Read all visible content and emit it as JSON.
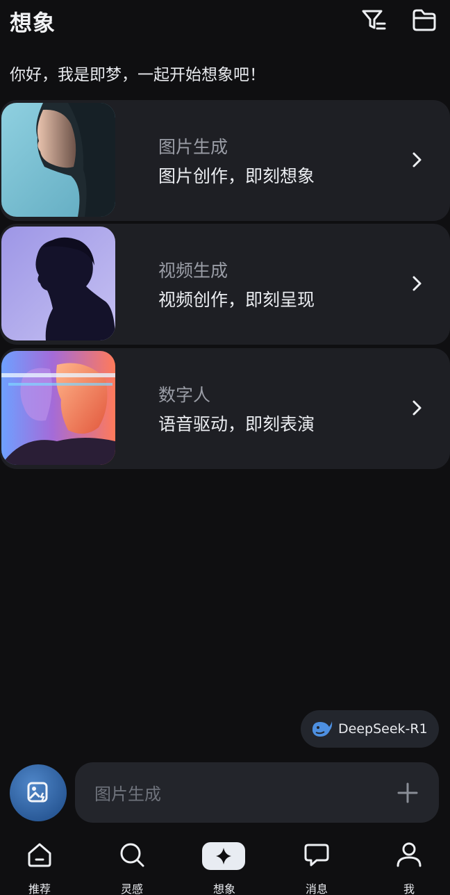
{
  "header": {
    "title": "想象",
    "filter_icon": "filter-list-icon",
    "folder_icon": "folder-icon"
  },
  "greeting": "你好，我是即梦，一起开始想象吧！",
  "cards": [
    {
      "title": "图片生成",
      "subtitle": "图片创作，即刻想象",
      "icon": "chevron-right-icon"
    },
    {
      "title": "视频生成",
      "subtitle": "视频创作，即刻呈现",
      "icon": "chevron-right-icon"
    },
    {
      "title": "数字人",
      "subtitle": "语音驱动，即刻表演",
      "icon": "chevron-right-icon"
    }
  ],
  "model_chip": {
    "label": "DeepSeek-R1",
    "icon": "whale-icon"
  },
  "prompt": {
    "placeholder": "图片生成",
    "mode_icon": "image-generate-icon",
    "add_icon": "plus-icon"
  },
  "tabs": [
    {
      "label": "推荐",
      "icon": "home-icon"
    },
    {
      "label": "灵感",
      "icon": "search-icon"
    },
    {
      "label": "想象",
      "icon": "sparkle-icon",
      "active": true
    },
    {
      "label": "消息",
      "icon": "chat-bubble-icon"
    },
    {
      "label": "我",
      "icon": "person-icon"
    }
  ],
  "colors": {
    "background": "#0f0f11",
    "card": "#1e1f24",
    "accent_blue": "#2b5b99",
    "deepseek_blue": "#4d8fe0"
  }
}
